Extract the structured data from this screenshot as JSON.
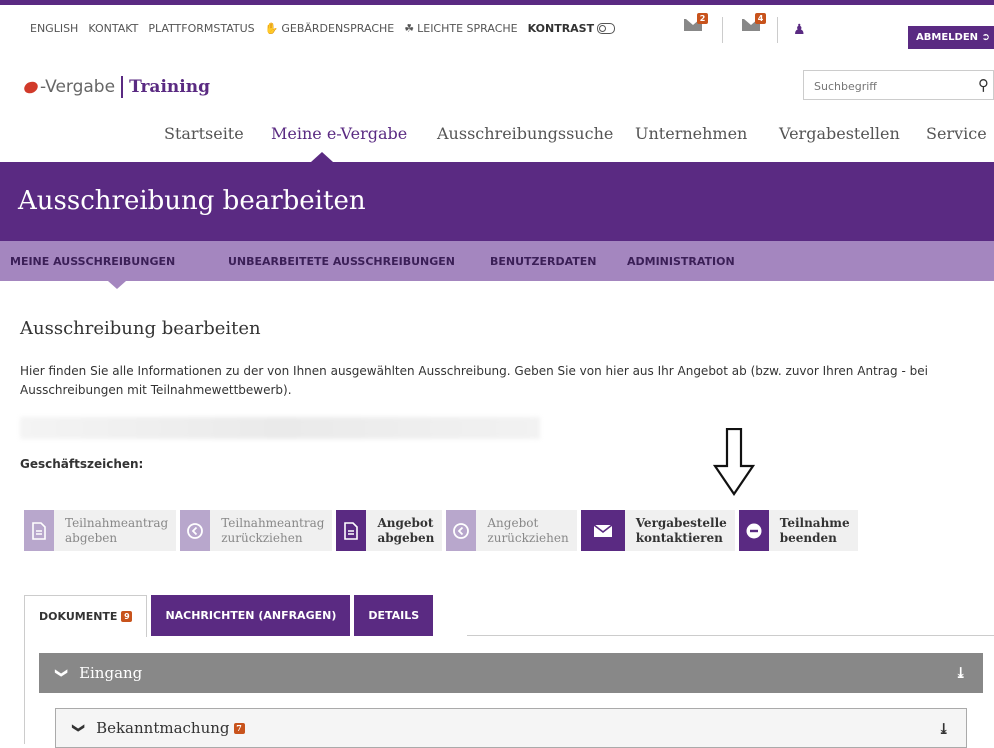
{
  "utility": {
    "english": "ENGLISH",
    "kontakt": "KONTAKT",
    "plattformstatus": "PLATTFORMSTATUS",
    "gebaerdensprache": "GEBÄRDENSPRACHE",
    "leichte_sprache": "LEICHTE SPRACHE",
    "kontrast": "KONTRAST"
  },
  "mail": {
    "inbox1_count": "2",
    "inbox2_count": "4"
  },
  "logout_label": "ABMELDEN",
  "brand": {
    "name": "-Vergabe",
    "product": "Training"
  },
  "search": {
    "placeholder": "Suchbegriff"
  },
  "nav": {
    "startseite": "Startseite",
    "meine": "Meine e-Vergabe",
    "suche": "Ausschreibungssuche",
    "unternehmen": "Unternehmen",
    "vergabestellen": "Vergabestellen",
    "service": "Service"
  },
  "banner_title": "Ausschreibung bearbeiten",
  "subnav": {
    "meine": "MEINE AUSSCHREIBUNGEN",
    "unbearbeitet": "UNBEARBEITETE AUSSCHREIBUNGEN",
    "benutzerdaten": "BENUTZERDATEN",
    "administration": "ADMINISTRATION"
  },
  "section_title": "Ausschreibung bearbeiten",
  "intro_text": "Hier finden Sie alle Informationen zu der von Ihnen ausgewählten Ausschreibung. Geben Sie von hier aus Ihr Angebot ab (bzw. zuvor Ihren Antrag - bei Ausschreibungen mit Teilnahmewettbewerb).",
  "gz_label": "Geschäftszeichen:",
  "actions": [
    {
      "line1": "Teilnahmeantrag",
      "line2": "abgeben"
    },
    {
      "line1": "Teilnahmeantrag",
      "line2": "zurückziehen"
    },
    {
      "line1": "Angebot",
      "line2": "abgeben"
    },
    {
      "line1": "Angebot",
      "line2": "zurückziehen"
    },
    {
      "line1": "Vergabestelle",
      "line2": "kontaktieren"
    },
    {
      "line1": "Teilnahme",
      "line2": "beenden"
    }
  ],
  "tabs": {
    "dokumente": "DOKUMENTE",
    "dokumente_count": "9",
    "nachrichten": "NACHRICHTEN (ANFRAGEN)",
    "details": "DETAILS"
  },
  "accordion": {
    "eingang": "Eingang",
    "bekanntmachung": "Bekanntmachung",
    "bekanntmachung_count": "7"
  },
  "colors": {
    "brand_purple": "#5a2a82",
    "subnav_purple": "#a486bf",
    "badge_orange": "#c8531c"
  }
}
